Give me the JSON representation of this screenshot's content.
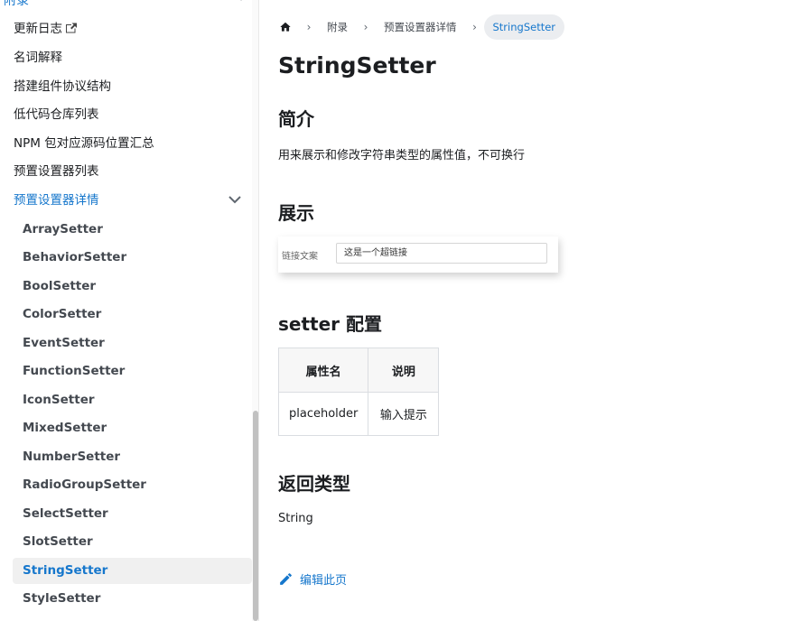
{
  "sidebar": {
    "top_category": "附录",
    "items": [
      {
        "label": "更新日志"
      },
      {
        "label": "名词解释"
      },
      {
        "label": "搭建组件协议结构"
      },
      {
        "label": "低代码仓库列表"
      },
      {
        "label": "NPM 包对应源码位置汇总"
      },
      {
        "label": "预置设置器列表"
      },
      {
        "label": "预置设置器详情"
      }
    ],
    "sub_items": [
      {
        "label": "ArraySetter"
      },
      {
        "label": "BehaviorSetter"
      },
      {
        "label": "BoolSetter"
      },
      {
        "label": "ColorSetter"
      },
      {
        "label": "EventSetter"
      },
      {
        "label": "FunctionSetter"
      },
      {
        "label": "IconSetter"
      },
      {
        "label": "MixedSetter"
      },
      {
        "label": "NumberSetter"
      },
      {
        "label": "RadioGroupSetter"
      },
      {
        "label": "SelectSetter"
      },
      {
        "label": "SlotSetter"
      },
      {
        "label": "StringSetter"
      },
      {
        "label": "StyleSetter"
      }
    ]
  },
  "breadcrumbs": [
    "附录",
    "预置设置器详情",
    "StringSetter"
  ],
  "content": {
    "title": "StringSetter",
    "intro_heading": "简介",
    "intro_text": "用来展示和修改字符串类型的属性值，不可换行",
    "demo_heading": "展示",
    "demo_label": "链接文案",
    "demo_value": "这是一个超链接",
    "config_heading": "setter 配置",
    "table": {
      "headers": [
        "属性名",
        "说明"
      ],
      "rows": [
        [
          "placeholder",
          "输入提示"
        ]
      ]
    },
    "return_heading": "返回类型",
    "return_text": "String",
    "edit_link": "编辑此页"
  },
  "colors": {
    "accent": "#1677cc",
    "text": "#1c1e21",
    "active_bg": "#f0f0f0"
  },
  "icons": [
    "external-link-icon",
    "chevron-down-icon",
    "home-icon",
    "chevron-right-icon",
    "edit-icon"
  ]
}
